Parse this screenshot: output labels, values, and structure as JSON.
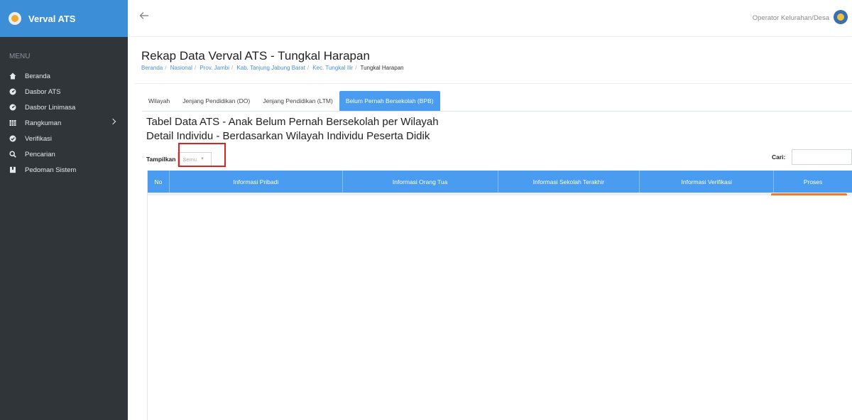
{
  "app": {
    "title": "Verval ATS"
  },
  "sidebar": {
    "menu_header": "MENU",
    "items": [
      {
        "label": "Beranda",
        "icon": "home-icon"
      },
      {
        "label": "Dasbor ATS",
        "icon": "gauge-icon"
      },
      {
        "label": "Dasbor Linimasa",
        "icon": "gauge-icon"
      },
      {
        "label": "Rangkuman",
        "icon": "table-icon"
      },
      {
        "label": "Verifikasi",
        "icon": "check-circle-icon"
      },
      {
        "label": "Pencarian",
        "icon": "search-icon"
      },
      {
        "label": "Pedoman Sistem",
        "icon": "book-icon"
      }
    ]
  },
  "topbar": {
    "user_label": "Operator Kelurahan/Desa"
  },
  "page": {
    "title": "Rekap Data Verval ATS - Tungkal Harapan",
    "breadcrumb": [
      "Beranda",
      "Nasional",
      "Prov. Jambi",
      "Kab. Tanjung Jabung Barat",
      "Kec. Tungkal Ilir",
      "Tungkal Harapan"
    ]
  },
  "tabs": [
    "Wilayah",
    "Jenjang Pendidikan (DO)",
    "Jenjang Pendidikan (LTM)",
    "Belum Pernah Bersekolah (BPB)"
  ],
  "section": {
    "title": "Tabel Data ATS - Anak Belum Pernah Bersekolah per Wilayah",
    "subtitle": "Detail Individu - Berdasarkan Wilayah Individu Peserta Didik"
  },
  "table_controls": {
    "length_label": "Tampilkan",
    "length_value": "Semu",
    "search_label": "Cari:"
  },
  "table": {
    "columns": [
      "No",
      "Informasi Pribadi",
      "Informasi Orang Tua",
      "Informasi Sekolah Terakhir",
      "Informasi Verifikasi",
      "Proses"
    ]
  },
  "colors": {
    "sidebar_bg": "#2f3539",
    "brand_bg": "#3c8ed6",
    "accent": "#4a9cf0",
    "highlight": "#e0201f",
    "action": "#f07a2a"
  }
}
